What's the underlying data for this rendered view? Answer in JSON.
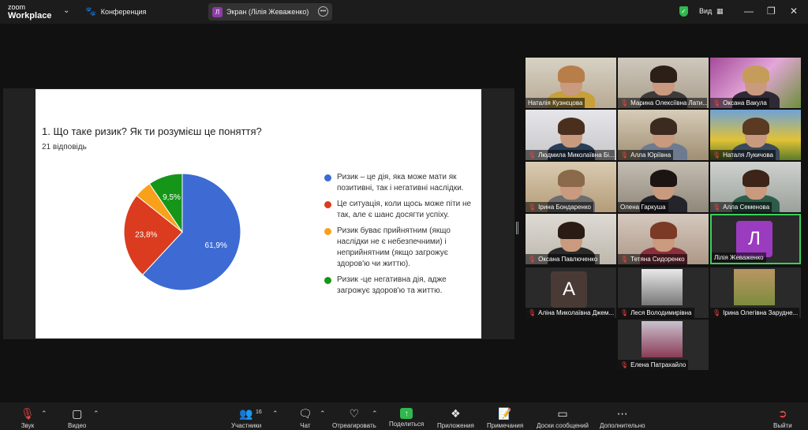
{
  "topbar": {
    "logo_line1": "zoom",
    "logo_line2": "Workplace",
    "meeting_label": "Конференция",
    "screen_initial": "Л",
    "screen_label": "Экран (Лілія Жеваженко)",
    "view_label": "Вид",
    "colors": {
      "shield": "#2fb84f",
      "screen_avatar": "#8e3ca6"
    }
  },
  "slide": {
    "question": "1.  Що таке ризик? Як ти розумієш це поняття?",
    "responses": "21 відповідь",
    "legend": [
      {
        "text": "Ризик – це дія, яка може мати як позитивні, так і негативні наслідки.",
        "color": "#3d6bd3"
      },
      {
        "text": "Це ситуація, коли щось може піти не так, але є шанс досягти успіху.",
        "color": "#db3b1e"
      },
      {
        "text": "Ризик буває прийнятним (якщо наслідки не є небезпечними) і неприйнятним (якщо загрожує здоров'ю чи життю).",
        "color": "#f9a11b"
      },
      {
        "text": "Ризик -це негативна дія, адже загрожує здоров'ю та життю.",
        "color": "#159619"
      }
    ]
  },
  "chart_data": {
    "type": "pie",
    "title": "1.  Що таке ризик? Як ти розумієш це поняття?",
    "subtitle": "21 відповідь",
    "categories": [
      "Ризик – це дія, яка може мати як позитивні, так і негативні наслідки.",
      "Це ситуація, коли щось може піти не так, але є шанс досягти успіху.",
      "Ризик буває прийнятним (якщо наслідки не є небезпечними) і неприйнятним (якщо загрожує здоров'ю чи життю).",
      "Ризик -це негативна дія, адже загрожує здоров'ю та життю."
    ],
    "values": [
      61.9,
      23.8,
      4.8,
      9.5
    ],
    "data_labels": [
      "61,9%",
      "23,8%",
      "",
      "9,5%"
    ],
    "colors": [
      "#3d6bd3",
      "#db3b1e",
      "#f9a11b",
      "#159619"
    ],
    "legend": "right"
  },
  "participants": [
    {
      "name": "Наталія Кузнєцова",
      "muted": false
    },
    {
      "name": "Марина Олексіївна Лати...",
      "muted": true
    },
    {
      "name": "Оксана Вакула",
      "muted": true
    },
    {
      "name": "Людмила Миколаївна Бі...",
      "muted": true
    },
    {
      "name": "Алла Юріївна",
      "muted": true
    },
    {
      "name": "Наталя Лукичова",
      "muted": true
    },
    {
      "name": "Ірина Бондаренко",
      "muted": true
    },
    {
      "name": "Олена Гаркуша",
      "muted": false
    },
    {
      "name": "Алла Семенова",
      "muted": true
    },
    {
      "name": "Оксана Павлюченко",
      "muted": true
    },
    {
      "name": "Тетяна Сидоренко",
      "muted": true
    },
    {
      "name": "Лілія Жеваженко",
      "muted": false,
      "initial": "Л",
      "avatar_color": "#9b3bbf"
    },
    {
      "name": "Аліна Миколаївна Джем...",
      "muted": true,
      "initial": "А",
      "avatar_color": "#4a3a36"
    },
    {
      "name": "Леся Володимирівна",
      "muted": true
    },
    {
      "name": "Ірина Олегівна Заруднe...",
      "muted": true
    },
    {
      "name": "Елена Патрахайло",
      "muted": true
    }
  ],
  "toolbar": {
    "audio": "Звук",
    "video": "Видео",
    "participants": "Участники",
    "participants_count": "16",
    "chat": "Чат",
    "react": "Отреагировать",
    "share": "Поделиться",
    "apps": "Приложения",
    "notes": "Примечания",
    "whiteboard": "Доски сообщений",
    "more": "Дополнительно",
    "leave": "Выйти"
  }
}
